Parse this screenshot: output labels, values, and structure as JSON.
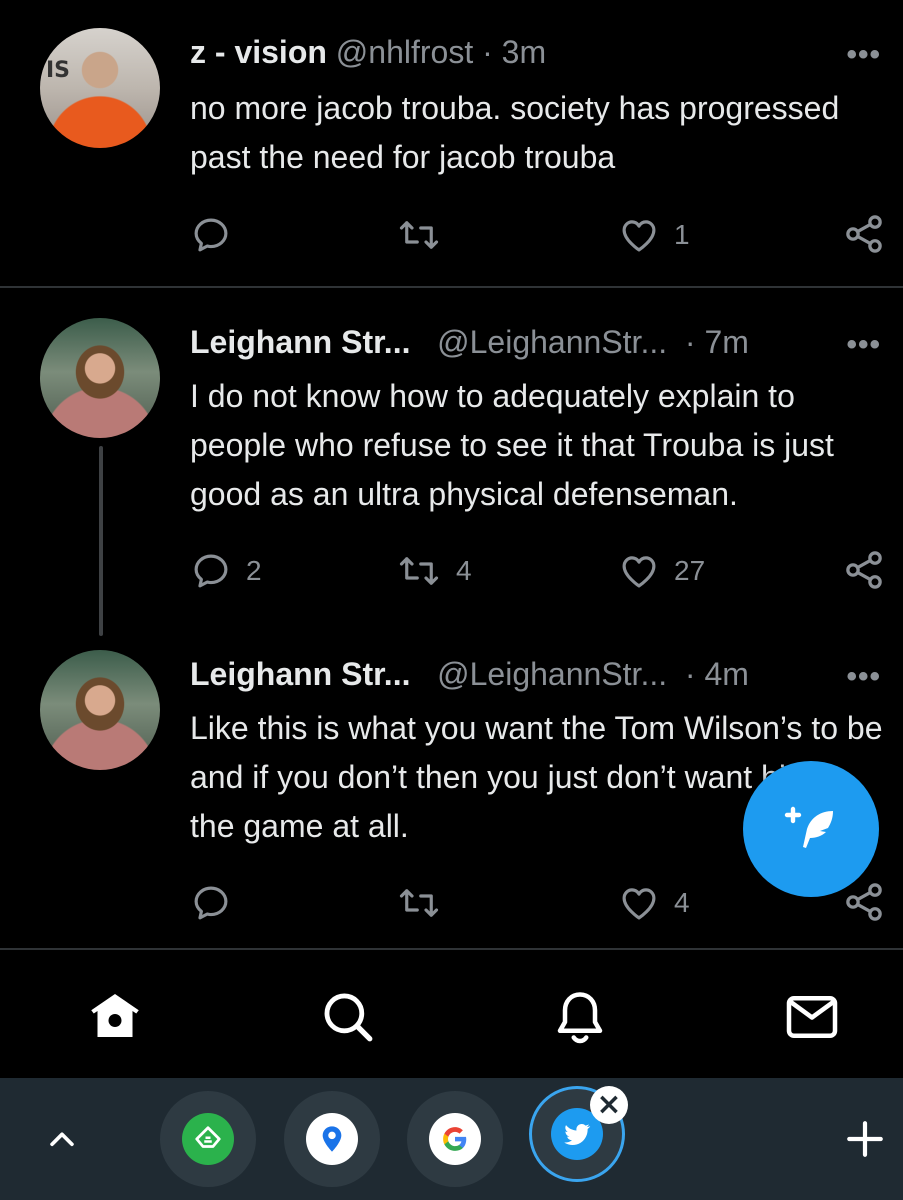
{
  "tweets": [
    {
      "name": "z - vision",
      "handle": "@nhlfrost",
      "dot": "·",
      "time": "3m",
      "text": "no more jacob trouba. society has progressed past the need for jacob trouba",
      "avatar_text": "IS",
      "replies": "",
      "retweets": "",
      "likes": "1"
    },
    {
      "name": "Leighann Str...",
      "handle": "@LeighannStr...",
      "dot": "·",
      "time": "7m",
      "text": "I do not know how to adequately explain to people who refuse to see it that Trouba is just good as an ultra physical defenseman.",
      "replies": "2",
      "retweets": "4",
      "likes": "27"
    },
    {
      "name": "Leighann Str...",
      "handle": "@LeighannStr...",
      "dot": "·",
      "time": "4m",
      "text": "Like this is what you want the Tom Wilson’s to be and if you don’t then you just don’t want hits in the game at all.",
      "replies": "",
      "retweets": "",
      "likes": "4"
    }
  ],
  "more_label": "•••",
  "tray": {
    "collapse_label": "^",
    "add_label": "+",
    "close_badge": "×"
  },
  "colors": {
    "accent": "#1d9bf0",
    "muted": "#8b9096",
    "text": "#e7e9ea",
    "tray_bg": "#1f2a32"
  },
  "icons": [
    "reply-icon",
    "retweet-icon",
    "like-icon",
    "share-icon",
    "compose-icon",
    "home-icon",
    "search-icon",
    "notifications-icon",
    "messages-icon"
  ]
}
